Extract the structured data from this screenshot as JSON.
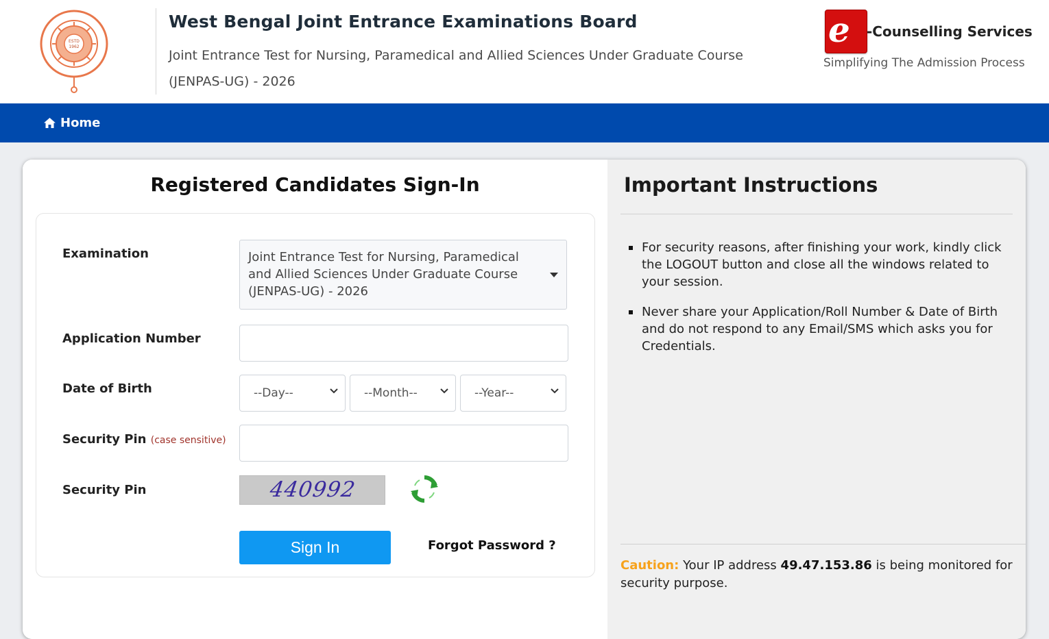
{
  "header": {
    "org_title": "West Bengal Joint Entrance Examinations Board",
    "org_subtitle": "Joint Entrance Test for Nursing, Paramedical and Allied Sciences Under Graduate Course (JENPAS-UG) - 2026",
    "logo_icon": "wbjeeb-emblem-icon",
    "brand": {
      "icon": "e-counselling-logo-icon",
      "icon_letter": "e",
      "name": "-Counselling Services",
      "tagline": "Simplifying The Admission Process",
      "color": "#d40f0f"
    }
  },
  "nav": {
    "home_label": "Home",
    "home_icon": "home-icon",
    "bg_color": "#004aad"
  },
  "signin": {
    "title": "Registered Candidates Sign-In",
    "examination_label": "Examination",
    "examination_value": "Joint Entrance Test for Nursing, Paramedical and Allied Sciences Under Graduate Course (JENPAS-UG) - 2026",
    "application_number_label": "Application Number",
    "application_number_value": "",
    "dob_label": "Date of Birth",
    "dob_day": "--Day--",
    "dob_month": "--Month--",
    "dob_year": "--Year--",
    "security_pin_input_label": "Security Pin",
    "security_pin_note": "(case sensitive)",
    "security_pin_value": "",
    "captcha_label": "Security Pin",
    "captcha_text": "440992",
    "refresh_icon": "refresh-icon",
    "signin_button": "Sign In",
    "signin_button_color": "#0f98f2",
    "forgot_password": "Forgot Password ?"
  },
  "instructions": {
    "title": "Important Instructions",
    "items": [
      "For security reasons, after finishing your work, kindly click the LOGOUT button and close all the windows related to your session.",
      "Never share your Application/Roll Number & Date of Birth and do not respond to any Email/SMS which asks you for Credentials."
    ],
    "caution_label": "Caution:",
    "caution_pre": "Your IP address",
    "ip_address": "49.47.153.86",
    "caution_post": "is being monitored for security purpose.",
    "caution_color": "#f7a21b"
  }
}
